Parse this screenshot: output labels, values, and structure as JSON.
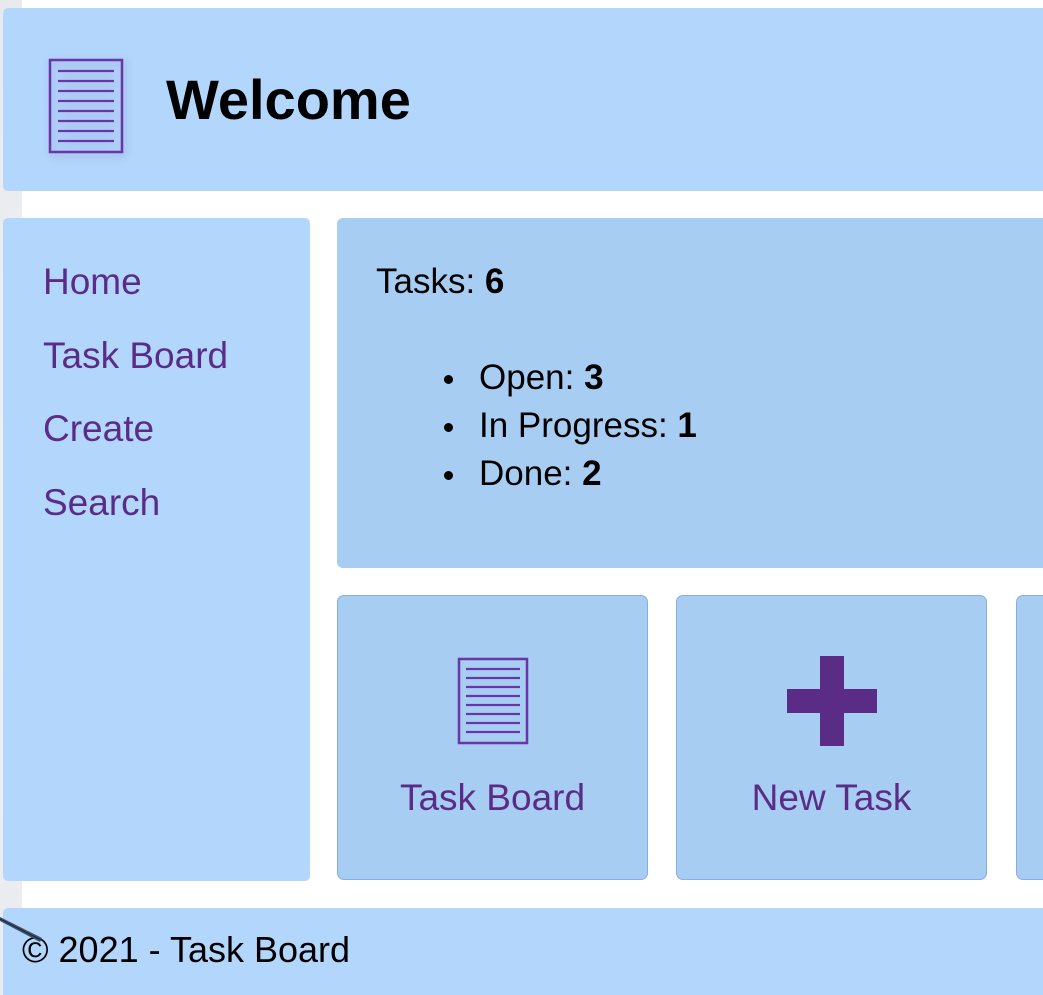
{
  "header": {
    "title": "Welcome",
    "icon": "document-lines-icon"
  },
  "sidebar": {
    "items": [
      {
        "label": "Home"
      },
      {
        "label": "Task Board"
      },
      {
        "label": "Create"
      },
      {
        "label": "Search"
      }
    ]
  },
  "summary": {
    "total_label": "Tasks: ",
    "total_value": "6",
    "statuses": [
      {
        "label": "Open: ",
        "value": "3"
      },
      {
        "label": "In Progress: ",
        "value": "1"
      },
      {
        "label": "Done: ",
        "value": "2"
      }
    ]
  },
  "tiles": [
    {
      "label": "Task Board",
      "icon": "document-lines-icon"
    },
    {
      "label": "New Task",
      "icon": "plus-icon"
    }
  ],
  "footer": {
    "text": "© 2021 - Task Board"
  },
  "colors": {
    "panel": "#b3d6fd",
    "card": "#a8cdf3",
    "accent": "#5b2c86"
  }
}
